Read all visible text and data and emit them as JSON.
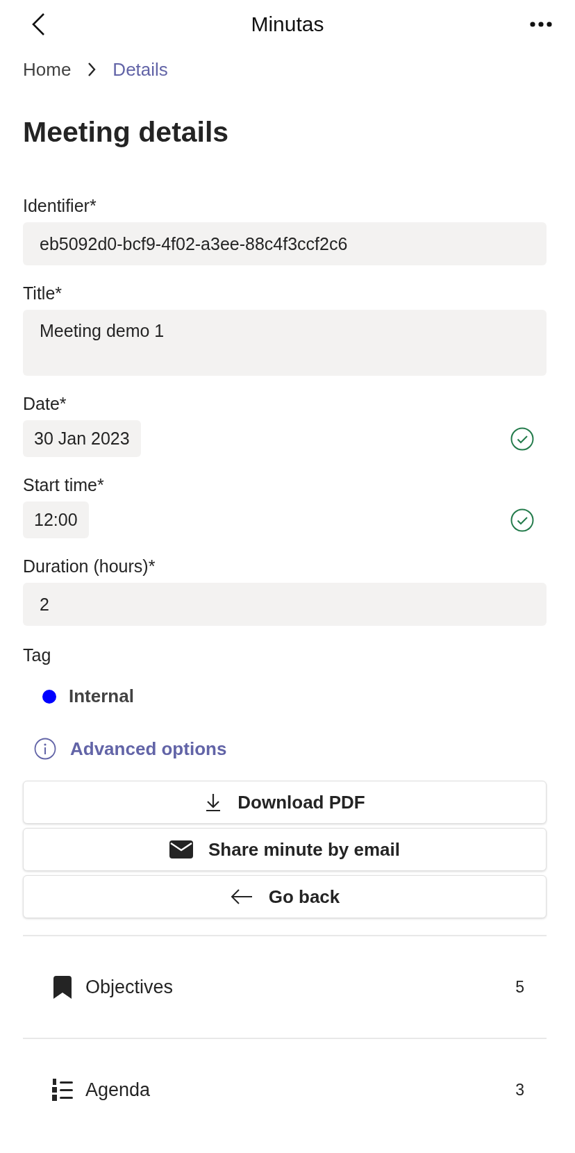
{
  "header": {
    "title": "Minutas"
  },
  "breadcrumb": [
    {
      "label": "Home",
      "selected": false
    },
    {
      "label": "Details",
      "selected": true
    }
  ],
  "heading": "Meeting details",
  "fields": [
    {
      "label": "Identifier*",
      "value": "eb5092d0-bcf9-4f02-a3ee-88c4f3ccf2c6",
      "kind": "full",
      "valid": false
    },
    {
      "label": "Title*",
      "value": "Meeting demo 1",
      "kind": "multiline",
      "valid": false
    },
    {
      "label": "Date*",
      "value": "30 Jan 2023",
      "kind": "compact",
      "valid": true
    },
    {
      "label": "Start time*",
      "value": "12:00",
      "kind": "compact",
      "valid": true
    },
    {
      "label": "Duration (hours)*",
      "value": "2",
      "kind": "full",
      "valid": false
    }
  ],
  "tag": {
    "label": "Tag",
    "items": [
      {
        "name": "Internal",
        "color": "#0000ff"
      }
    ]
  },
  "advanced_options": "Advanced options",
  "buttons": [
    {
      "label": "Download PDF",
      "kind": "download"
    },
    {
      "label": "Share minute by email",
      "kind": "email"
    },
    {
      "label": "Go back",
      "kind": "back"
    }
  ],
  "sections": [
    {
      "label": "Objectives",
      "count": "5",
      "kind": "bookmark"
    },
    {
      "label": "Agenda",
      "count": "3",
      "kind": "numbered-list"
    }
  ]
}
